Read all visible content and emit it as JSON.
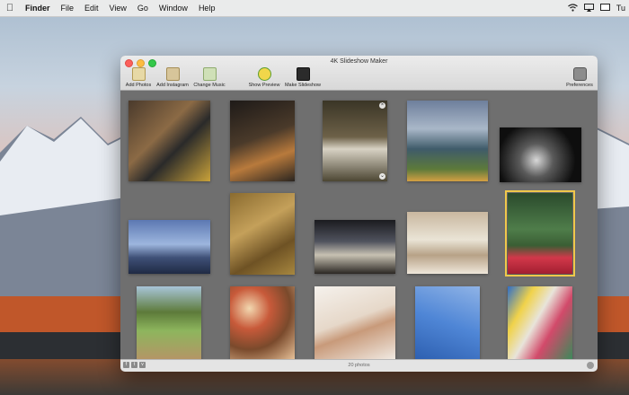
{
  "menubar": {
    "apple_icon": "apple-logo-icon",
    "items": [
      "Finder",
      "File",
      "Edit",
      "View",
      "Go",
      "Window",
      "Help"
    ],
    "status_icons": [
      "wifi-icon",
      "airplay-icon",
      "display-icon"
    ],
    "clock": "Tu"
  },
  "window": {
    "title": "4K Slideshow Maker",
    "toolbar": {
      "add_photos": "Add Photos",
      "add_instagram": "Add Instagram",
      "change_music": "Change Music",
      "show_preview": "Show Preview",
      "make_slideshow": "Make Slideshow",
      "preferences": "Preferences"
    },
    "status": {
      "count": "20 photos",
      "social_icons": [
        "facebook-icon",
        "twitter-icon",
        "vimeo-icon"
      ]
    }
  },
  "colors": {
    "selection": "#f0c84a",
    "grid_bg": "#6f6f6f"
  }
}
